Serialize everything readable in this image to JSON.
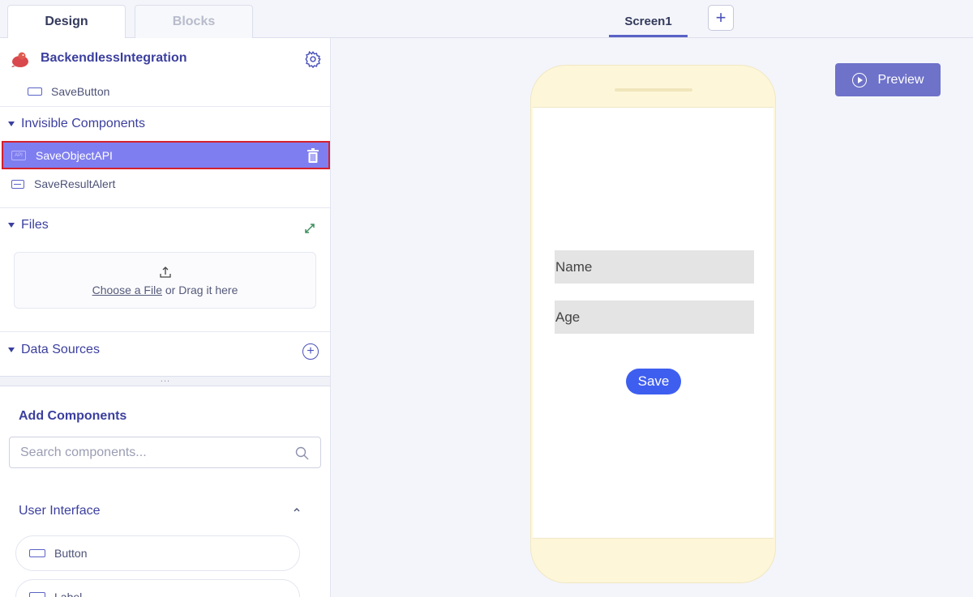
{
  "tabs": {
    "design": "Design",
    "blocks": "Blocks"
  },
  "screen_tab": "Screen1",
  "add_screen": "+",
  "project": {
    "name": "BackendlessIntegration"
  },
  "components": {
    "save_button": "SaveButton",
    "invisible_header": "Invisible Components",
    "save_object_api": "SaveObjectAPI",
    "save_result_alert": "SaveResultAlert"
  },
  "files": {
    "header": "Files",
    "choose": "Choose a File",
    "drag": " or Drag it here"
  },
  "data_sources": {
    "header": "Data Sources",
    "add": "+"
  },
  "splitter": "...",
  "add_components": {
    "title": "Add Components",
    "search_placeholder": "Search components...",
    "category": "User Interface",
    "items": [
      "Button",
      "Label"
    ]
  },
  "preview": {
    "label": "Preview"
  },
  "phone": {
    "name_placeholder": "Name",
    "age_placeholder": "Age",
    "save_label": "Save"
  },
  "colors": {
    "accent": "#5a62c6",
    "selected_row": "#7f7ef0",
    "selection_border": "#d4202c",
    "preview_button": "#6e72c9",
    "save_button": "#3e5ef0",
    "phone_frame": "#fdf6d9"
  }
}
